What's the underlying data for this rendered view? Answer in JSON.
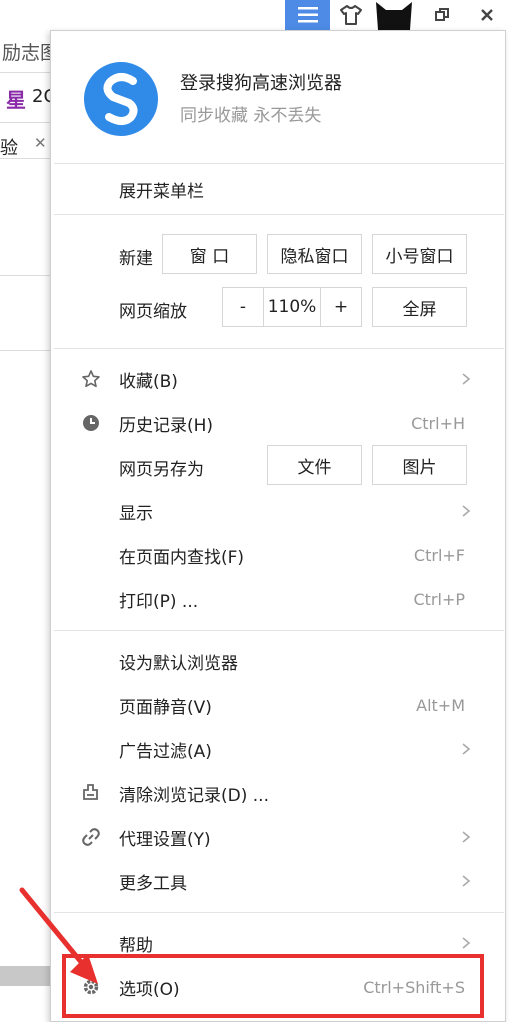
{
  "background": {
    "frag1": "励志图",
    "frag2": "2C",
    "frag3": "验",
    "close_glyph": "✕"
  },
  "account": {
    "title": "登录搜狗高速浏览器",
    "subtitle": "同步收藏 永不丢失"
  },
  "menu": {
    "expand_menubar": "展开菜单栏",
    "new_label": "新建",
    "new_window": "窗 口",
    "private_window": "隐私窗口",
    "small_window": "小号窗口",
    "zoom_label": "网页缩放",
    "zoom_minus": "-",
    "zoom_value": "110%",
    "zoom_plus": "+",
    "fullscreen": "全屏",
    "favorites": "收藏(B)",
    "history": "历史记录(H)",
    "history_shortcut": "Ctrl+H",
    "save_as": "网页另存为",
    "save_file": "文件",
    "save_image": "图片",
    "display": "显示",
    "find": "在页面内查找(F)",
    "find_shortcut": "Ctrl+F",
    "print": "打印(P) ...",
    "print_shortcut": "Ctrl+P",
    "default_browser": "设为默认浏览器",
    "mute": "页面静音(V)",
    "mute_shortcut": "Alt+M",
    "adblock": "广告过滤(A)",
    "clear_history": "清除浏览记录(D) ...",
    "proxy": "代理设置(Y)",
    "more_tools": "更多工具",
    "help": "帮助",
    "options": "选项(O)",
    "options_shortcut": "Ctrl+Shift+S"
  },
  "colors": {
    "accent": "#4d8be6",
    "highlight_red": "#e8312f"
  }
}
